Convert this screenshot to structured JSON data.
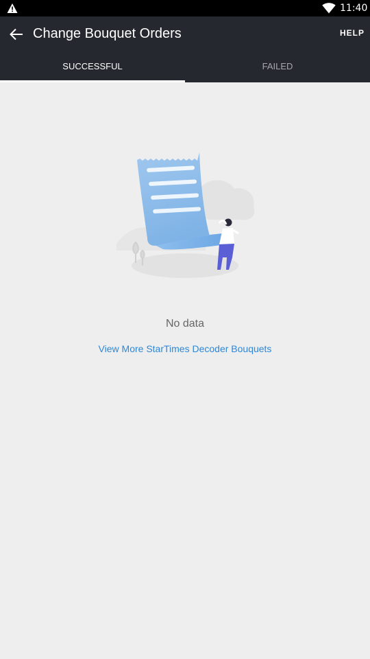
{
  "status_bar": {
    "time": "11:40",
    "icons": [
      "warning-icon",
      "wifi-icon"
    ]
  },
  "app_bar": {
    "back_icon": "arrow-left-icon",
    "title": "Change Bouquet Orders",
    "help_label": "HELP"
  },
  "tabs": [
    {
      "label": "SUCCESSFUL",
      "selected": true
    },
    {
      "label": "FAILED",
      "selected": false
    }
  ],
  "empty_state": {
    "illustration": "receipt-with-person-illustration",
    "message": "No data",
    "link_text": "View More StarTimes Decoder Bouquets"
  },
  "colors": {
    "app_bar": "#25282e",
    "background": "#eeeeee",
    "link": "#2d87d8",
    "tab_inactive": "#a6a8ad"
  }
}
